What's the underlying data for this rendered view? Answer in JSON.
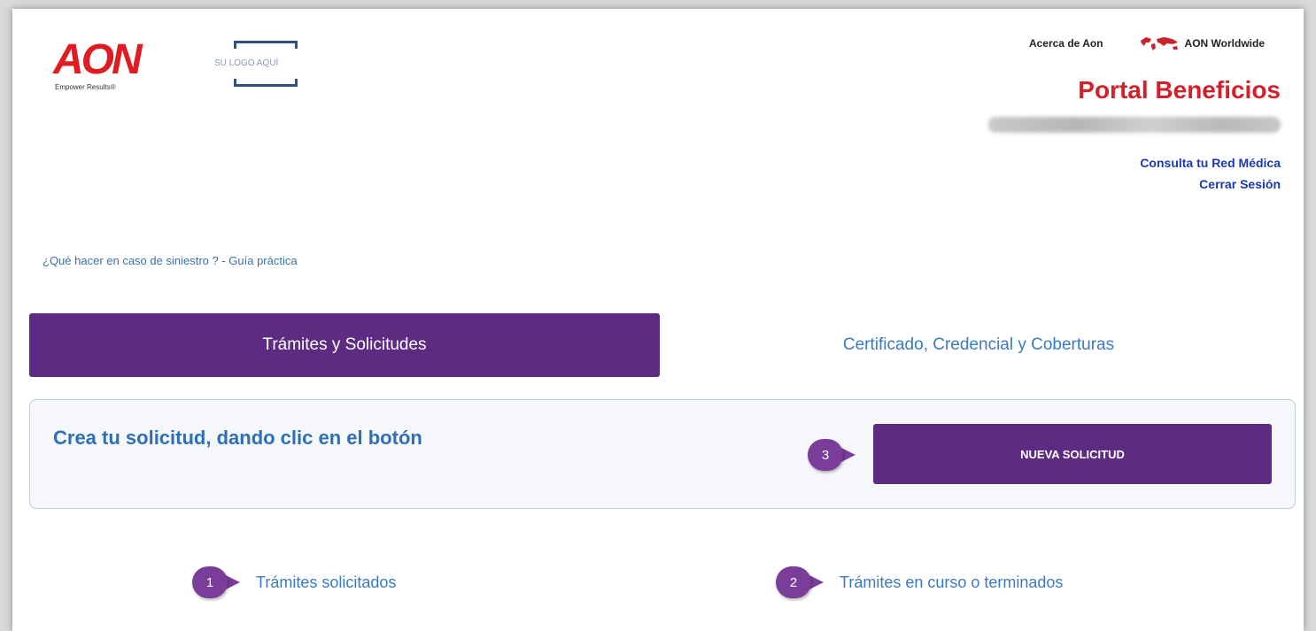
{
  "header": {
    "brand": "AON",
    "brand_tagline": "Empower Results®",
    "client_logo_text": "SU LOGO AQUÍ",
    "about_link": "Acerca de Aon",
    "worldwide_link": "AON Worldwide",
    "portal_title": "Portal Beneficios",
    "medical_network_link": "Consulta tu Red Médica",
    "logout_link": "Cerrar Sesión"
  },
  "guide_link": "¿Qué hacer en caso de siniestro ? - Guía práctica",
  "tabs": [
    {
      "label": "Trámites y Solicitudes",
      "active": true
    },
    {
      "label": "Certificado, Credencial y Coberturas",
      "active": false
    }
  ],
  "create_panel": {
    "prompt": "Crea tu solicitud, dando clic en el botón",
    "step": "3",
    "button_label": "NUEVA SOLICITUD"
  },
  "bottom_links": [
    {
      "step": "1",
      "label": "Trámites solicitados"
    },
    {
      "step": "2",
      "label": "Trámites en curso o terminados"
    }
  ],
  "colors": {
    "brand_red": "#e11b22",
    "purple": "#5e2b82",
    "link_blue": "#3a7bbf",
    "dark_link_blue": "#1b38b5"
  }
}
